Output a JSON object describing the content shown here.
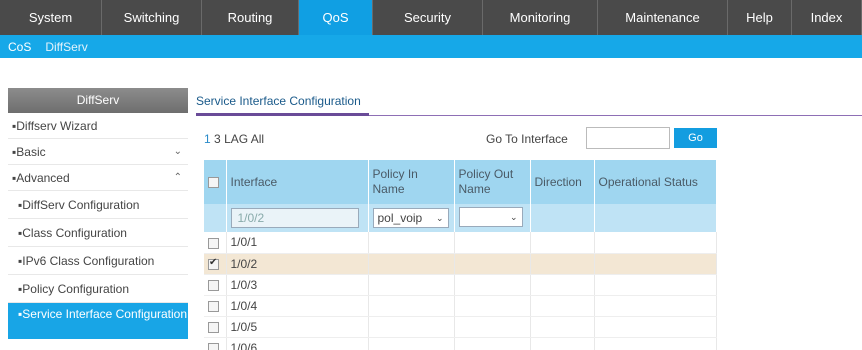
{
  "topnav": {
    "tabs": [
      {
        "label": "System",
        "width": 0
      },
      {
        "label": "Switching"
      },
      {
        "label": "Routing"
      },
      {
        "label": "QoS",
        "active": true
      },
      {
        "label": "Security"
      },
      {
        "label": "Monitoring"
      },
      {
        "label": "Maintenance"
      },
      {
        "label": "Help"
      },
      {
        "label": "Index"
      }
    ]
  },
  "subnav": {
    "items": [
      "CoS",
      "DiffServ"
    ]
  },
  "sidebar": {
    "header": "DiffServ",
    "items": [
      {
        "label": "Diffserv Wizard"
      },
      {
        "label": "Basic",
        "chevron": "⌄"
      },
      {
        "label": "Advanced",
        "chevron": "⌃"
      },
      {
        "label": "DiffServ Configuration"
      },
      {
        "label": "Class Configuration"
      },
      {
        "label": "IPv6 Class Configuration"
      },
      {
        "label": "Policy Configuration"
      },
      {
        "label": "Service Interface Configuration"
      }
    ]
  },
  "content": {
    "title": "Service Interface Configuration",
    "lag_links": [
      "1",
      "3",
      "LAG",
      "All"
    ],
    "go_to_interface_label": "Go To Interface",
    "go_button": "Go",
    "table": {
      "headers": [
        "Interface",
        "Policy In Name",
        "Policy Out Name",
        "Direction",
        "Operational Status"
      ],
      "filter": {
        "interface": "1/0/2",
        "policy_in": "pol_voip",
        "policy_out": ""
      },
      "rows": [
        {
          "interface": "1/0/1",
          "checked": false
        },
        {
          "interface": "1/0/2",
          "checked": true
        },
        {
          "interface": "1/0/3",
          "checked": false
        },
        {
          "interface": "1/0/4",
          "checked": false
        },
        {
          "interface": "1/0/5",
          "checked": false
        },
        {
          "interface": "1/0/6",
          "checked": false
        }
      ]
    }
  }
}
